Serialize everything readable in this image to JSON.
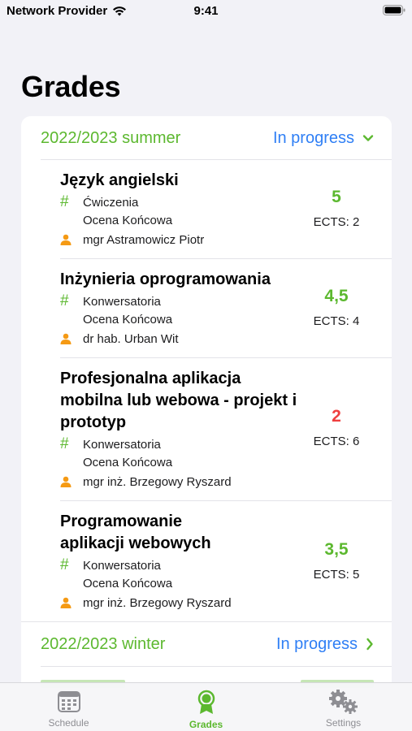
{
  "status": {
    "carrier": "Network Provider",
    "time": "9:41"
  },
  "page": {
    "title": "Grades"
  },
  "terms": [
    {
      "name": "2022/2023 summer",
      "status": "In progress",
      "expanded": true
    },
    {
      "name": "2022/2023 winter",
      "status": "In progress",
      "expanded": false
    }
  ],
  "courses": [
    {
      "name": "Język angielski",
      "type": "Ćwiczenia",
      "assessment": "Ocena Końcowa",
      "lecturer": "mgr Astramowicz Piotr",
      "grade": "5",
      "ects": "ECTS: 2"
    },
    {
      "name": "Inżynieria oprogramowania",
      "type": "Konwersatoria",
      "assessment": "Ocena Końcowa",
      "lecturer": "dr hab. Urban Wit",
      "grade": "4,5",
      "ects": "ECTS: 4"
    },
    {
      "name": "Profesjonalna aplikacja mobilna lub webowa - projekt i prototyp",
      "type": "Konwersatoria",
      "assessment": "Ocena Końcowa",
      "lecturer": "mgr inż. Brzegowy Ryszard",
      "grade": "2",
      "ects": "ECTS: 6"
    },
    {
      "name": "Programowanie aplikacji webowych",
      "type": "Konwersatoria",
      "assessment": "Ocena Końcowa",
      "lecturer": "mgr inż. Brzegowy Ryszard",
      "grade": "3,5",
      "ects": "ECTS: 5"
    }
  ],
  "tabs": [
    {
      "label": "Schedule",
      "icon": "calendar-icon",
      "active": false
    },
    {
      "label": "Grades",
      "icon": "award-icon",
      "active": true
    },
    {
      "label": "Settings",
      "icon": "gears-icon",
      "active": false
    }
  ],
  "colors": {
    "accent": "#5cb82f",
    "link": "#2f7ff5",
    "failing": "#ef3f3f",
    "lecturer_icon": "#f59a14"
  }
}
